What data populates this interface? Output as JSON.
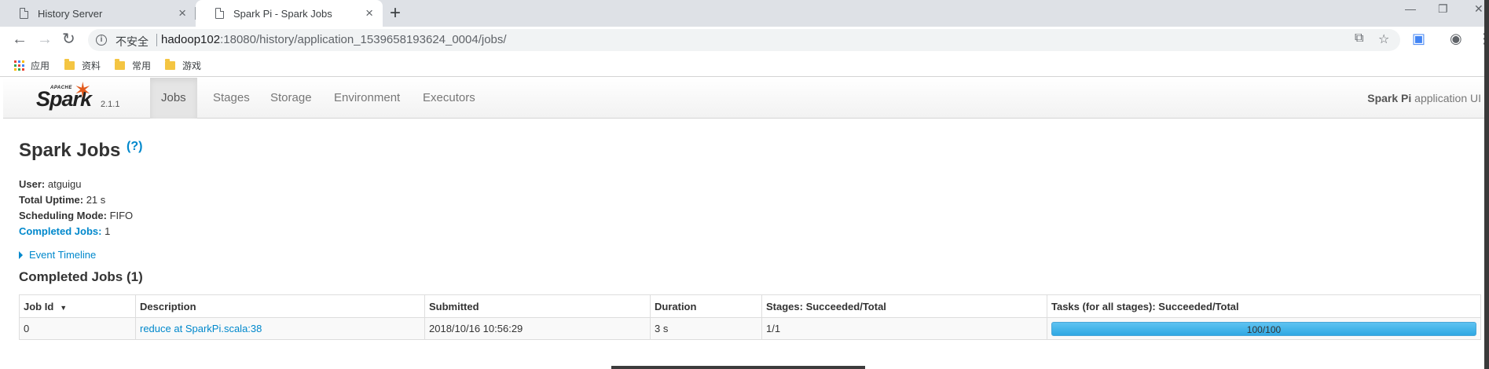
{
  "browser": {
    "tabs": [
      {
        "title": "History Server",
        "active": false
      },
      {
        "title": "Spark Pi - Spark Jobs",
        "active": true
      }
    ],
    "new_tab": "+",
    "window_controls": {
      "minimize": "—",
      "restore": "❐",
      "close": "✕"
    },
    "nav": {
      "back": "←",
      "forward": "→",
      "reload": "↻"
    },
    "security_label": "不安全",
    "url_host": "hadoop102",
    "url_rest": ":18080/history/application_1539658193624_0004/jobs/",
    "bookmarks": [
      "应用",
      "资料",
      "常用",
      "游戏"
    ],
    "icons": [
      "info-icon",
      "translate-icon",
      "star-icon",
      "extension-icon",
      "account-icon",
      "menu-icon"
    ]
  },
  "spark": {
    "brand": {
      "apache": "APACHE",
      "name": "Spark",
      "version": "2.1.1"
    },
    "nav_tabs": [
      "Jobs",
      "Stages",
      "Storage",
      "Environment",
      "Executors"
    ],
    "active_tab": "Jobs",
    "app_name": "Spark Pi",
    "app_suffix": " application UI",
    "page_title": "Spark Jobs",
    "help": "(?)",
    "summary": {
      "user_label": "User:",
      "user": " atguigu",
      "uptime_label": "Total Uptime:",
      "uptime": " 21 s",
      "scheduling_label": "Scheduling Mode:",
      "scheduling": " FIFO",
      "completed_label": "Completed Jobs:",
      "completed": " 1"
    },
    "event_timeline": "Event Timeline",
    "section_title": "Completed Jobs (1)",
    "table": {
      "headers": [
        "Job Id",
        "Description",
        "Submitted",
        "Duration",
        "Stages: Succeeded/Total",
        "Tasks (for all stages): Succeeded/Total"
      ],
      "sort_indicator": "▼",
      "rows": [
        {
          "job_id": "0",
          "description": "reduce at SparkPi.scala:38",
          "submitted": "2018/10/16 10:56:29",
          "duration": "3 s",
          "stages": "1/1",
          "tasks": "100/100",
          "tasks_fraction": 1.0
        }
      ]
    }
  },
  "colors": {
    "link": "#0088cc",
    "spark_orange": "#e25a1c",
    "progress": "#3eb1e8"
  }
}
